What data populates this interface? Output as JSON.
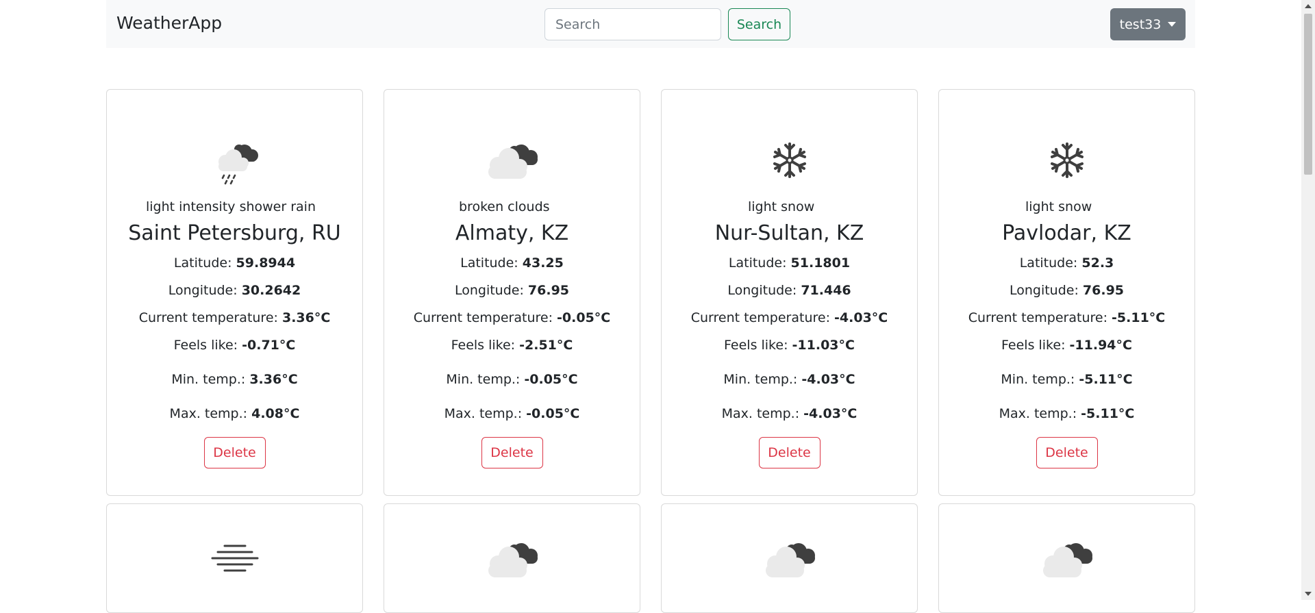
{
  "app": {
    "brand": "WeatherApp"
  },
  "search": {
    "placeholder": "Search",
    "button_label": "Search"
  },
  "user": {
    "name": "test33"
  },
  "labels": {
    "latitude": "Latitude:",
    "longitude": "Longitude:",
    "current_temp": "Current temperature:",
    "feels_like": "Feels like:",
    "min_temp": "Min. temp.:",
    "max_temp": "Max. temp.:",
    "delete": "Delete"
  },
  "cards": [
    {
      "icon": "shower-rain-icon",
      "description": "light intensity shower rain",
      "city": "Saint Petersburg, RU",
      "latitude": "59.8944",
      "longitude": "30.2642",
      "current_temp": "3.36°C",
      "feels_like": "-0.71°C",
      "min_temp": "3.36°C",
      "max_temp": "4.08°C"
    },
    {
      "icon": "broken-clouds-icon",
      "description": "broken clouds",
      "city": "Almaty, KZ",
      "latitude": "43.25",
      "longitude": "76.95",
      "current_temp": "-0.05°C",
      "feels_like": "-2.51°C",
      "min_temp": "-0.05°C",
      "max_temp": "-0.05°C"
    },
    {
      "icon": "snow-icon",
      "description": "light snow",
      "city": "Nur-Sultan, KZ",
      "latitude": "51.1801",
      "longitude": "71.446",
      "current_temp": "-4.03°C",
      "feels_like": "-11.03°C",
      "min_temp": "-4.03°C",
      "max_temp": "-4.03°C"
    },
    {
      "icon": "snow-icon",
      "description": "light snow",
      "city": "Pavlodar, KZ",
      "latitude": "52.3",
      "longitude": "76.95",
      "current_temp": "-5.11°C",
      "feels_like": "-11.94°C",
      "min_temp": "-5.11°C",
      "max_temp": "-5.11°C"
    }
  ],
  "partial_cards": [
    {
      "icon": "mist-icon"
    },
    {
      "icon": "broken-clouds-icon"
    },
    {
      "icon": "broken-clouds-icon"
    },
    {
      "icon": "broken-clouds-icon"
    }
  ]
}
